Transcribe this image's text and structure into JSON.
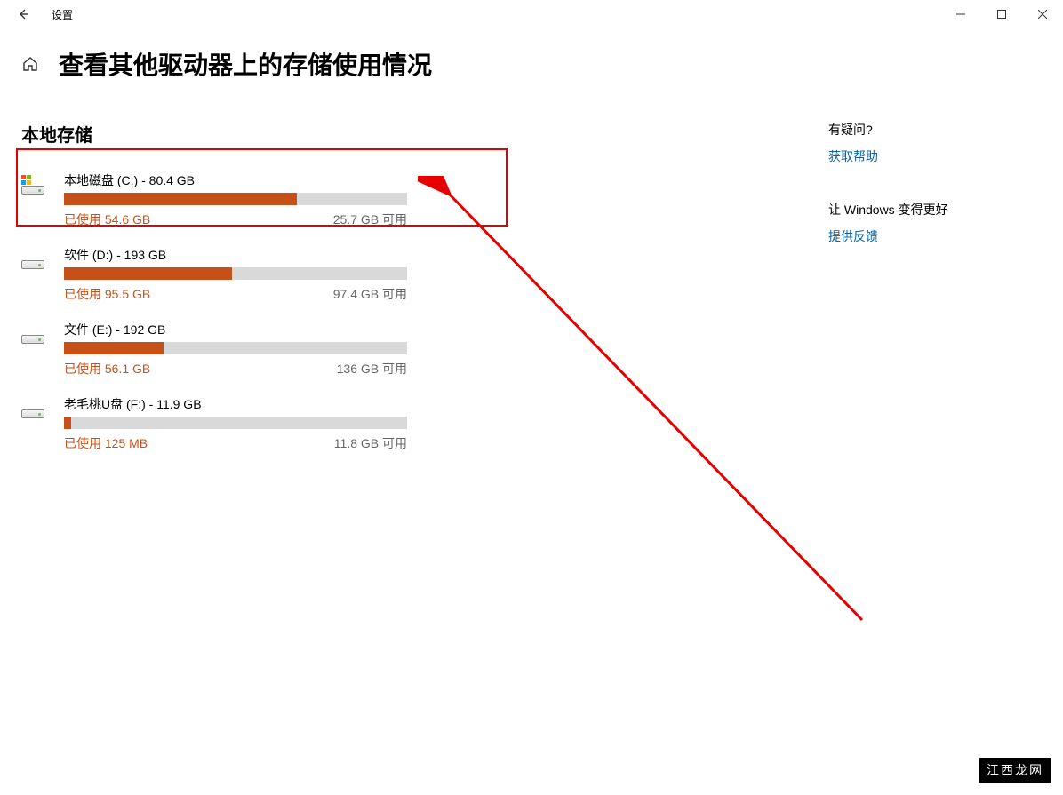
{
  "window": {
    "title": "设置"
  },
  "header": {
    "title": "查看其他驱动器上的存储使用情况"
  },
  "main": {
    "section_title": "本地存储",
    "drives": [
      {
        "name": "本地磁盘 (C:) - 80.4 GB",
        "used_label": "已使用 54.6 GB",
        "avail_label": "25.7 GB 可用",
        "fill_percent": 68,
        "system": true
      },
      {
        "name": "软件 (D:) - 193 GB",
        "used_label": "已使用 95.5 GB",
        "avail_label": "97.4 GB 可用",
        "fill_percent": 49,
        "system": false
      },
      {
        "name": "文件 (E:) - 192 GB",
        "used_label": "已使用 56.1 GB",
        "avail_label": "136 GB 可用",
        "fill_percent": 29,
        "system": false
      },
      {
        "name": "老毛桃U盘 (F:) - 11.9 GB",
        "used_label": "已使用 125 MB",
        "avail_label": "11.8 GB 可用",
        "fill_percent": 2,
        "system": false
      }
    ]
  },
  "sidebar": {
    "question": "有疑问?",
    "help_link": "获取帮助",
    "improve_title": "让 Windows 变得更好",
    "feedback_link": "提供反馈"
  },
  "watermark": "江西龙网",
  "colors": {
    "accent": "#c75018",
    "highlight": "#e60000",
    "link": "#0a63a6"
  }
}
